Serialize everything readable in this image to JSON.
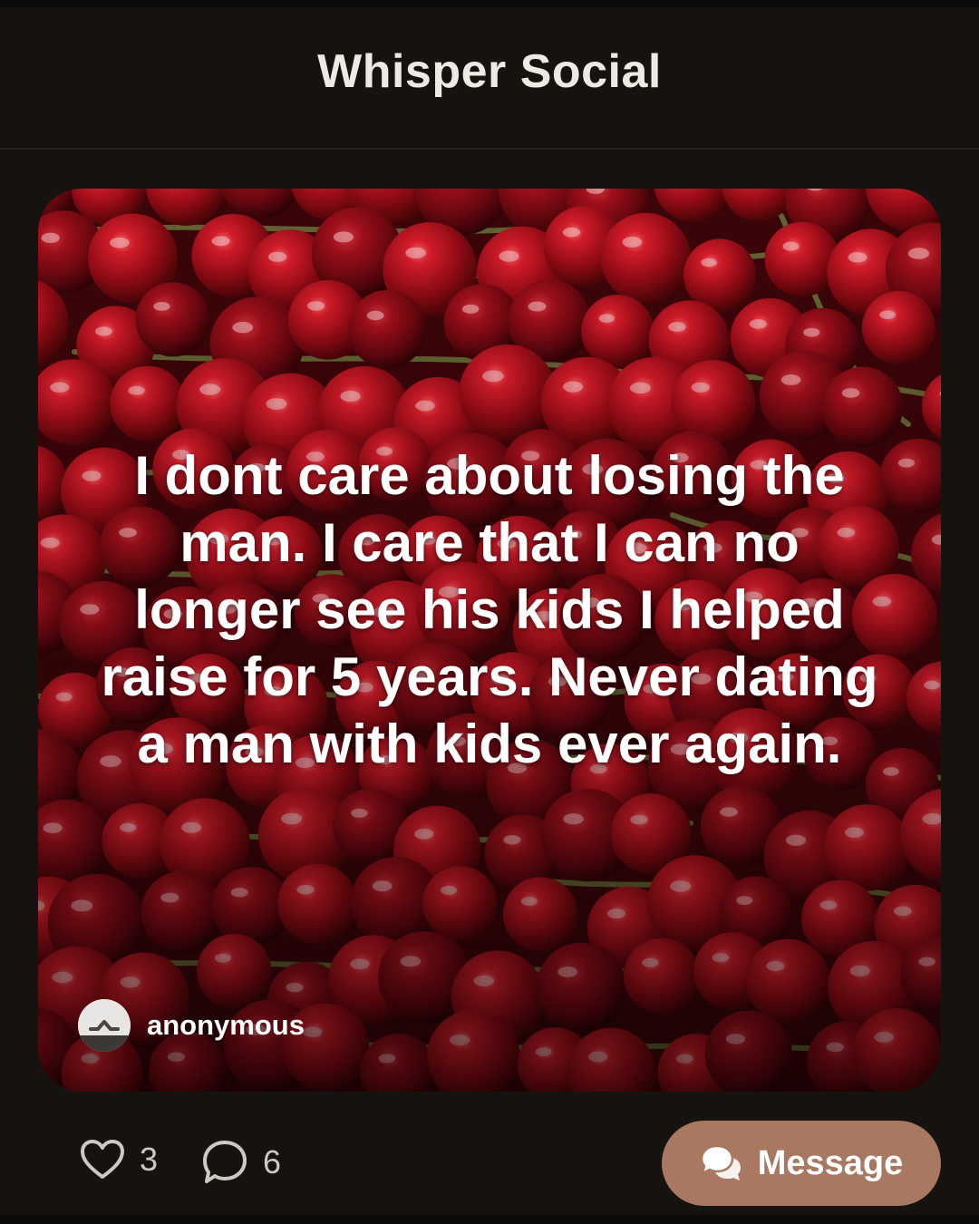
{
  "header": {
    "title": "Whisper Social"
  },
  "post": {
    "text": "I dont care about losing the man. I care that I can no longer see his kids I helped raise for 5 years. Never dating a man with kids ever again.",
    "author": "anonymous",
    "background_icon": "red-currants-photo",
    "avatar_icon": "anonymous-avatar-icon"
  },
  "actions": {
    "like_icon": "heart-icon",
    "like_count": "3",
    "comment_icon": "comment-icon",
    "comment_count": "6",
    "message_icon": "chat-bubbles-icon",
    "message_label": "Message"
  },
  "colors": {
    "background": "#15120f",
    "header_text": "#efe9e3",
    "message_button": "#a97860",
    "stat_text": "#cfc8c2"
  }
}
